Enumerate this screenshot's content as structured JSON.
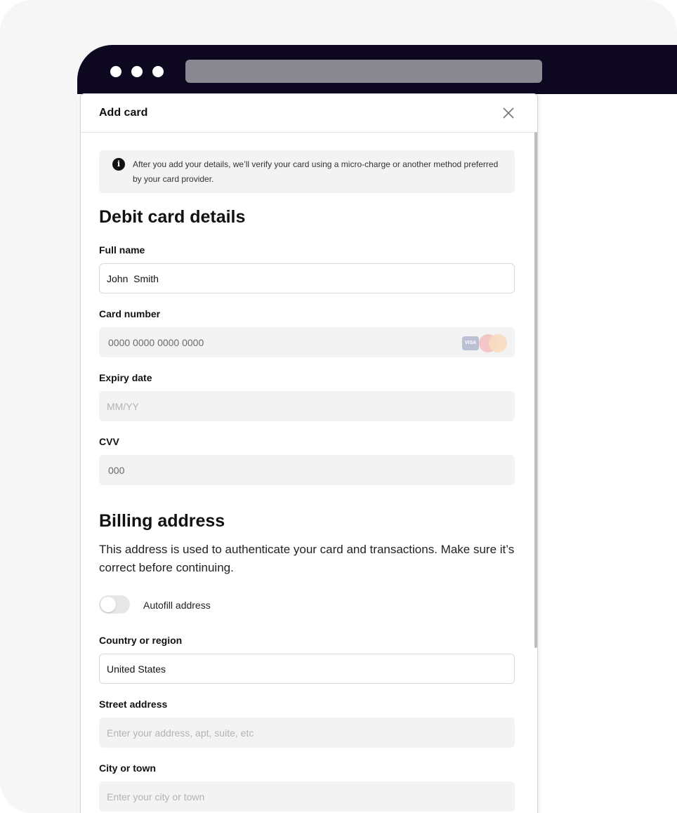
{
  "modal": {
    "title": "Add card",
    "info_text": "After you add your details, we’ll verify your card using a micro-charge or another method preferred by your card provider."
  },
  "debit_card": {
    "title": "Debit card details",
    "full_name": {
      "label": "Full name",
      "value": "John  Smith"
    },
    "card_number": {
      "label": "Card number",
      "placeholder": "0000 0000 0000 0000",
      "card_brands": [
        "VISA",
        "mastercard"
      ]
    },
    "expiry": {
      "label": "Expiry date",
      "placeholder": "MM/YY"
    },
    "cvv": {
      "label": "CVV",
      "placeholder": "000"
    }
  },
  "billing": {
    "title": "Billing address",
    "description": "This address is used to authenticate your card and transactions. Make sure it’s correct before continuing.",
    "autofill": {
      "label": "Autofill address",
      "on": false
    },
    "country": {
      "label": "Country or region",
      "value": "United States"
    },
    "street": {
      "label": "Street address",
      "placeholder": "Enter your address, apt, suite, etc"
    },
    "city": {
      "label": "City or town",
      "placeholder": "Enter your city or town"
    }
  },
  "icons": {
    "info": "info-icon",
    "close": "close-icon"
  },
  "colors": {
    "browser_bar": "#0d0720",
    "field_grey": "#f3f3f3",
    "text": "#111111"
  }
}
